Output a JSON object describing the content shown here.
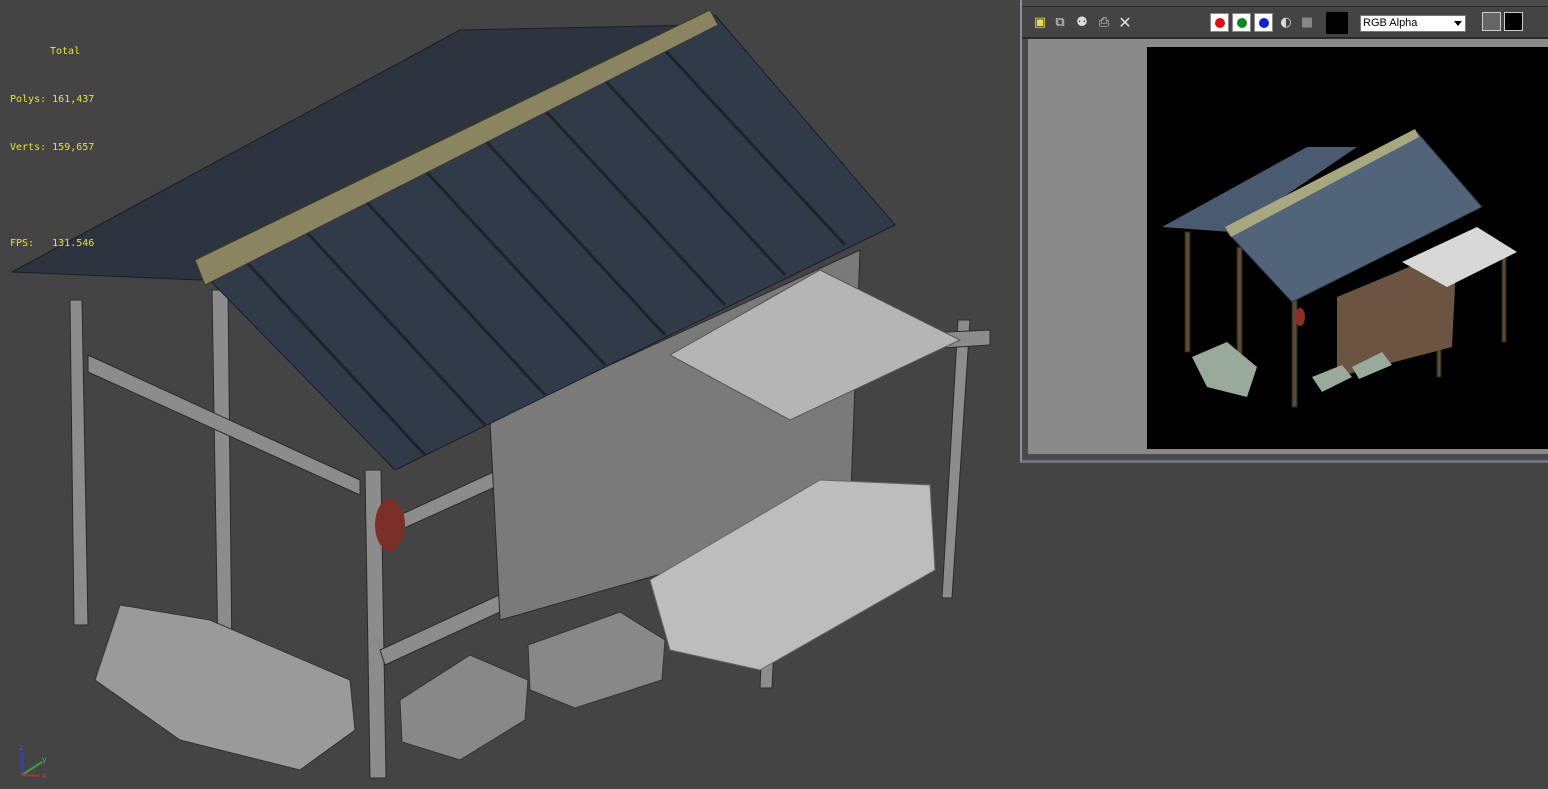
{
  "viewport": {
    "stats": {
      "header": "Total",
      "polys_label": "Polys:",
      "polys_value": "161,437",
      "verts_label": "Verts:",
      "verts_value": "159,657",
      "fps_label": "FPS:",
      "fps_value": "131.546"
    },
    "axis_gizmo": {
      "z": "z",
      "y": "y",
      "x": "x"
    },
    "colors": {
      "background": "#444444",
      "stats_text": "#e6e23a",
      "roof": "#2c3440",
      "wood": "#8a8a8a"
    }
  },
  "frame_buffer": {
    "toolbar": {
      "icons": [
        "save-icon",
        "copy-icon",
        "clone-icon",
        "print-icon",
        "clear-icon"
      ],
      "channels": [
        {
          "name": "red-channel",
          "color": "#e01010"
        },
        {
          "name": "green-channel",
          "color": "#0a8a1a"
        },
        {
          "name": "blue-channel",
          "color": "#1020d0"
        }
      ],
      "channel_select": "RGB Alpha",
      "swatch_color": "#000000"
    },
    "colors": {
      "background": "#8a8a8a",
      "render_bg": "#000000"
    }
  }
}
